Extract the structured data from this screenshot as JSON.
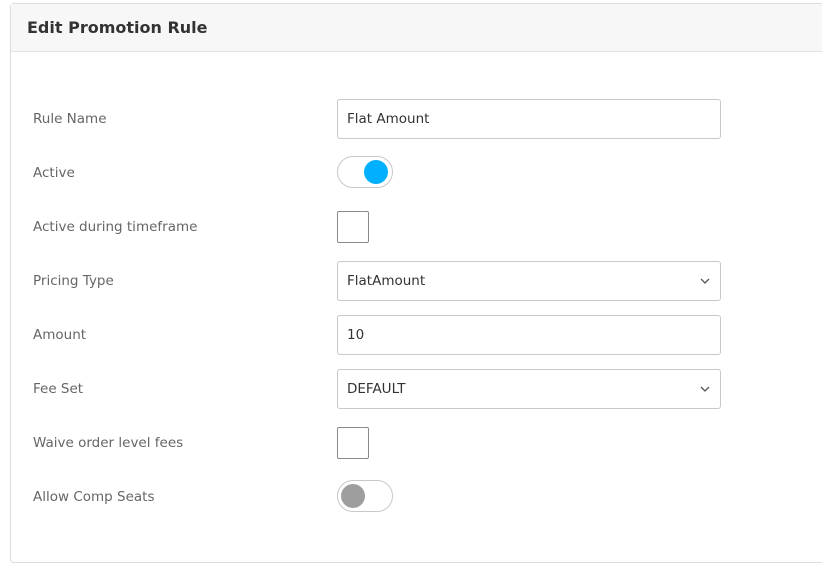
{
  "panel": {
    "title": "Edit Promotion Rule"
  },
  "form": {
    "rule_name": {
      "label": "Rule Name",
      "value": "Flat Amount"
    },
    "active": {
      "label": "Active",
      "state": "on"
    },
    "active_during_timeframe": {
      "label": "Active during timeframe",
      "checked": false
    },
    "pricing_type": {
      "label": "Pricing Type",
      "selected": "FlatAmount"
    },
    "amount": {
      "label": "Amount",
      "value": "10"
    },
    "fee_set": {
      "label": "Fee Set",
      "selected": "DEFAULT"
    },
    "waive_order_level_fees": {
      "label": "Waive order level fees",
      "checked": false
    },
    "allow_comp_seats": {
      "label": "Allow Comp Seats",
      "state": "off"
    }
  },
  "colors": {
    "toggle_on": "#00b0ff",
    "toggle_off": "#9e9e9e",
    "label_text": "#666666"
  },
  "icons": {
    "select_arrow": "chevron-down-icon"
  }
}
